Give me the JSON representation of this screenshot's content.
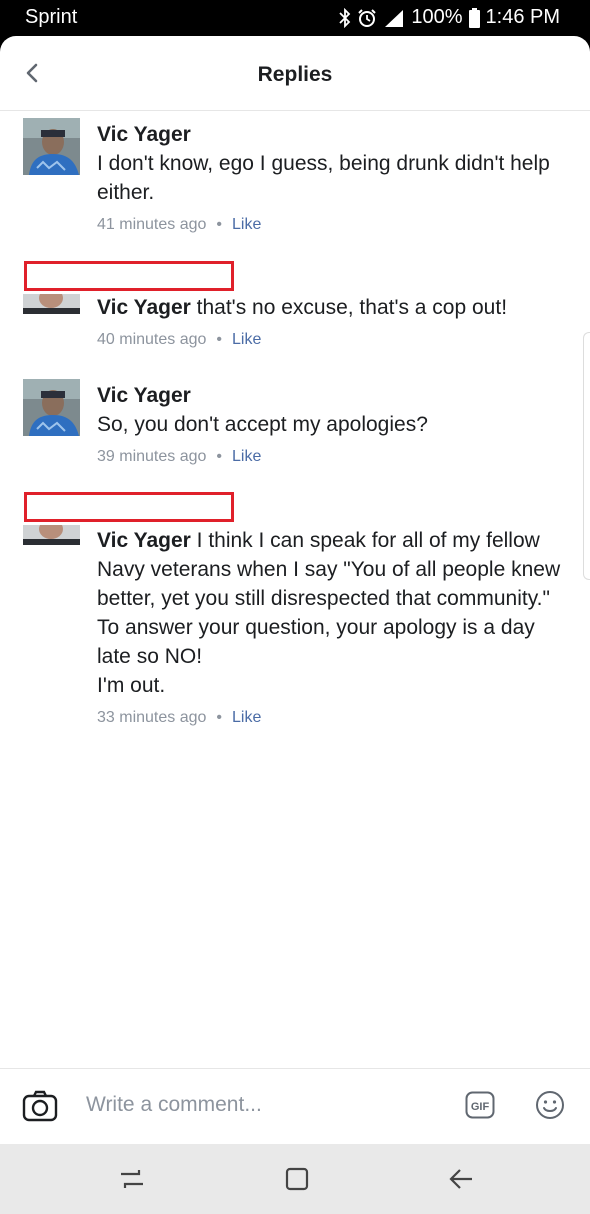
{
  "status_bar": {
    "carrier": "Sprint",
    "battery": "100%",
    "time": "1:46 PM",
    "icons": [
      "bluetooth-icon",
      "alarm-icon",
      "lte-signal-icon",
      "battery-icon"
    ]
  },
  "header": {
    "title": "Replies"
  },
  "comments": [
    {
      "author": "Vic Yager",
      "text": "I don't know,  ego I guess,  being drunk didn't help either.",
      "time": "41 minutes ago",
      "like": "Like"
    },
    {
      "author": "Vic Yager",
      "text": "that's no excuse, that's a cop out!",
      "time": "40 minutes ago",
      "like": "Like"
    },
    {
      "author": "Vic Yager",
      "text": "So, you don't accept my apologies?",
      "time": "39 minutes ago",
      "like": "Like"
    },
    {
      "author": "Vic Yager",
      "lines": [
        "I think I can speak for all of my fellow Navy veterans when I say \"You of all people knew better, yet you still disrespected that community.\"",
        "To answer your question, your apology is a day late so NO!",
        "I'm out."
      ],
      "time": "33 minutes ago",
      "like": "Like"
    }
  ],
  "composer": {
    "placeholder": "Write a comment..."
  },
  "colors": {
    "like": "#4b6ca6",
    "meta": "#8d949e",
    "redaction": "#e0202a"
  }
}
